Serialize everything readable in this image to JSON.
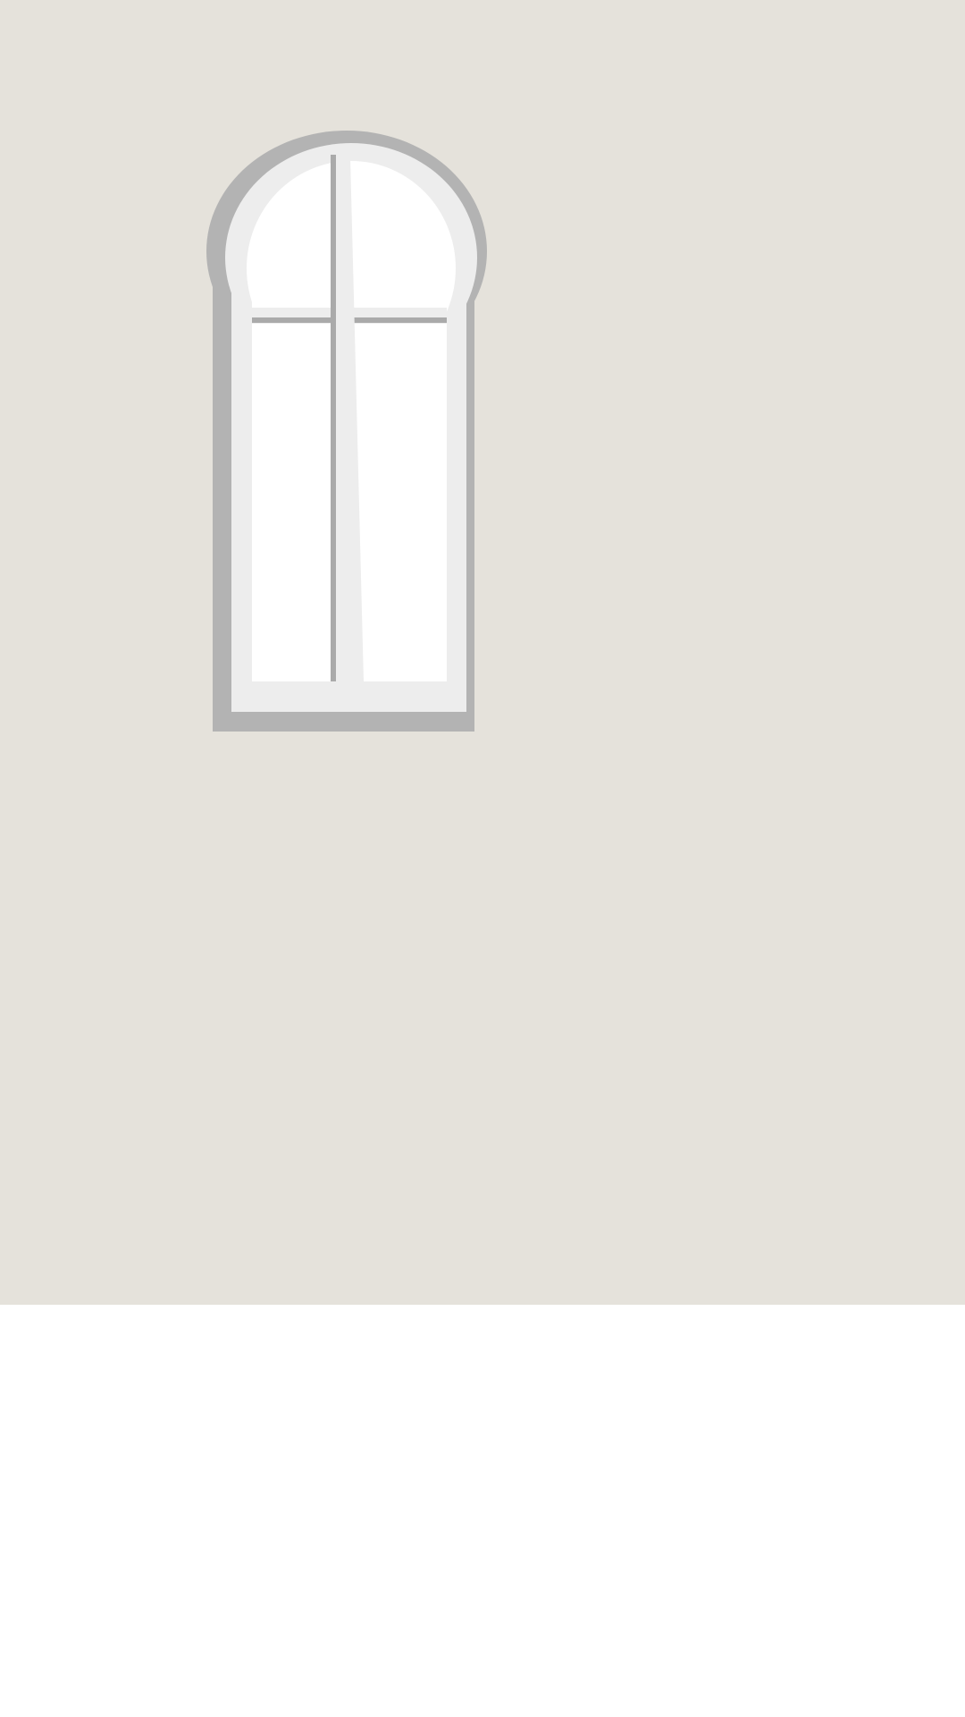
{
  "scene": {
    "wall_color": "#e5e2db",
    "floor_color": "#ffffff",
    "window": {
      "outer_frame_color": "#b3b3b3",
      "inner_frame_color": "#ededed",
      "glass_color": "#ffffff",
      "muntin_color": "#aaaaaa",
      "panes": 4,
      "shape": "arched"
    }
  }
}
